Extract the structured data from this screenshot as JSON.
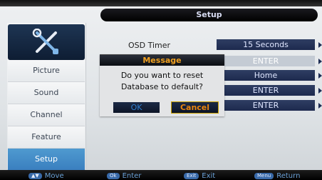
{
  "header": {
    "title": "Setup"
  },
  "sidebar": {
    "items": [
      {
        "label": "Picture"
      },
      {
        "label": "Sound"
      },
      {
        "label": "Channel"
      },
      {
        "label": "Feature"
      },
      {
        "label": "Setup",
        "active": true
      }
    ]
  },
  "settings": {
    "osd_timer_label": "OSD Timer",
    "osd_timer_value": "15 Seconds",
    "row2_value": "ENTER",
    "row3_value": "Home",
    "row4_value": "ENTER",
    "row5_value": "ENTER"
  },
  "dialog": {
    "title": "Message",
    "line1": "Do you want to reset",
    "line2": "Database to default?",
    "ok_label": "OK",
    "cancel_label": "Cancel"
  },
  "help_bar": [
    {
      "key": "▲▼",
      "action": "Move"
    },
    {
      "key": "Ok",
      "action": "Enter"
    },
    {
      "key": "Exit",
      "action": "Exit"
    },
    {
      "key": "Menu",
      "action": "Return"
    }
  ],
  "colors": {
    "highlight": "#3a7fbf",
    "pill": "#1d2a4e",
    "dialog_title_text": "#f0a020",
    "cancel_text": "#e9850f"
  }
}
